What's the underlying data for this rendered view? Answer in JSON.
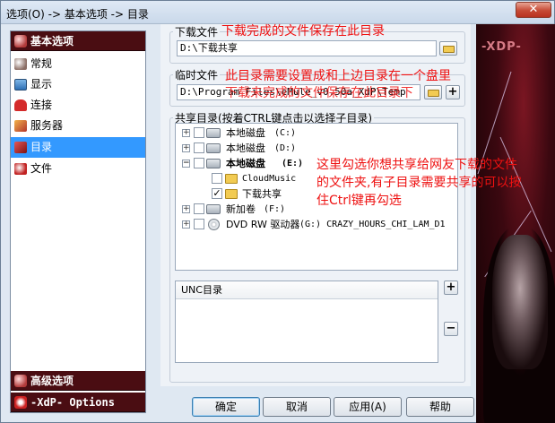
{
  "window": {
    "title": "选项(O) -> 基本选项 -> 目录",
    "close_glyph": "✕"
  },
  "nav": {
    "basic_header": "基本选项",
    "items": [
      {
        "label": "常规",
        "icon": "general-icon"
      },
      {
        "label": "显示",
        "icon": "display-icon"
      },
      {
        "label": "连接",
        "icon": "connection-icon"
      },
      {
        "label": "服务器",
        "icon": "server-icon"
      },
      {
        "label": "目录",
        "icon": "directory-icon",
        "selected": true
      },
      {
        "label": "文件",
        "icon": "file-icon"
      }
    ],
    "advanced_header": "高级选项",
    "xdp_header": "-XdP- Options"
  },
  "download": {
    "label": "下载文件",
    "value": "D:\\下载共享"
  },
  "temp": {
    "label": "临时文件",
    "value": "D:\\Program Files\\eMule_v0.50a_XdP\\Temp"
  },
  "shared": {
    "label": "共享目录(按着CTRL键点击以选择子目录)",
    "tree": [
      {
        "name": "本地磁盘",
        "drive": "(C:)"
      },
      {
        "name": "本地磁盘",
        "drive": "(D:)"
      },
      {
        "name": "本地磁盘",
        "drive": "(E:)"
      },
      {
        "name": "CloudMusic"
      },
      {
        "name": "下载共享",
        "check": "✓"
      },
      {
        "name": "新加卷",
        "drive": "(F:)"
      },
      {
        "name": "DVD RW 驱动器",
        "drive": "(G:) CRAZY_HOURS_CHI_LAM_D1"
      }
    ]
  },
  "unc": {
    "header": "UNC目录",
    "add": "+",
    "remove": "−"
  },
  "buttons": {
    "ok": "确定",
    "cancel": "取消",
    "apply": "应用(A)",
    "help": "帮助"
  },
  "art": {
    "logo": "-XDP-"
  },
  "annotations": {
    "a1": "下载完成的文件保存在此目录",
    "a2_line1": "此目录需要设置成和上边目录在一个盘里",
    "a2_line2": "下载未完成的文件保存在此目录下",
    "a3_line1": "这里勾选你想共享给网友下载的文件",
    "a3_line2": "的文件夹,有子目录需要共享的可以按",
    "a3_line3": "住Ctrl键再勾选"
  },
  "colors": {
    "accent": "#3399ff",
    "nav_header": "#4a0d12",
    "annotation": "#ee1111"
  }
}
